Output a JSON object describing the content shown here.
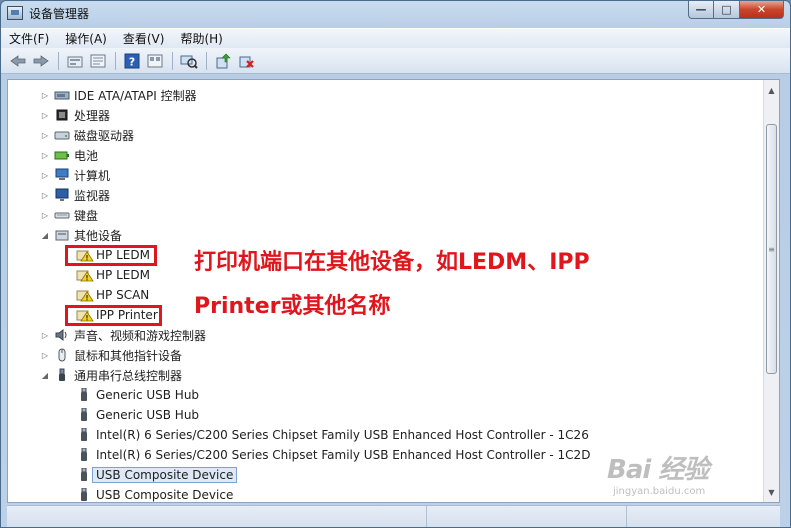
{
  "window": {
    "title": "设备管理器"
  },
  "caption": {
    "minimize": "—",
    "maximize": "□",
    "close": "✕"
  },
  "menu": [
    "文件(F)",
    "操作(A)",
    "查看(V)",
    "帮助(H)"
  ],
  "toolbar": [
    "back-arrow-icon",
    "forward-arrow-icon",
    "up-folder-icon",
    "properties-icon",
    "help-icon",
    "view-icon",
    "scan-hardware-icon",
    "update-driver-icon",
    "uninstall-icon"
  ],
  "tree": [
    {
      "label": "IDE ATA/ATAPI 控制器",
      "icon": "ide-controller-icon",
      "expander": "▷",
      "level": 0
    },
    {
      "label": "处理器",
      "icon": "processor-icon",
      "expander": "▷",
      "level": 0
    },
    {
      "label": "磁盘驱动器",
      "icon": "disk-drive-icon",
      "expander": "▷",
      "level": 0
    },
    {
      "label": "电池",
      "icon": "battery-icon",
      "expander": "▷",
      "level": 0
    },
    {
      "label": "计算机",
      "icon": "computer-icon",
      "expander": "▷",
      "level": 0
    },
    {
      "label": "监视器",
      "icon": "monitor-icon",
      "expander": "▷",
      "level": 0
    },
    {
      "label": "键盘",
      "icon": "keyboard-icon",
      "expander": "▷",
      "level": 0
    },
    {
      "label": "其他设备",
      "icon": "other-devices-icon",
      "expander": "◢",
      "level": 0
    },
    {
      "label": "HP LEDM",
      "icon": "unknown-device-warning-icon",
      "expander": "",
      "level": 1
    },
    {
      "label": "HP LEDM",
      "icon": "unknown-device-warning-icon",
      "expander": "",
      "level": 1
    },
    {
      "label": "HP SCAN",
      "icon": "unknown-device-warning-icon",
      "expander": "",
      "level": 1
    },
    {
      "label": "IPP Printer",
      "icon": "unknown-device-warning-icon",
      "expander": "",
      "level": 1
    },
    {
      "label": "声音、视频和游戏控制器",
      "icon": "sound-icon",
      "expander": "▷",
      "level": 0
    },
    {
      "label": "鼠标和其他指针设备",
      "icon": "mouse-icon",
      "expander": "▷",
      "level": 0
    },
    {
      "label": "通用串行总线控制器",
      "icon": "usb-controller-icon",
      "expander": "◢",
      "level": 0
    },
    {
      "label": "Generic USB Hub",
      "icon": "usb-plug-icon",
      "expander": "",
      "level": 1
    },
    {
      "label": "Generic USB Hub",
      "icon": "usb-plug-icon",
      "expander": "",
      "level": 1
    },
    {
      "label": "Intel(R) 6 Series/C200 Series Chipset Family USB Enhanced Host Controller - 1C26",
      "icon": "usb-plug-icon",
      "expander": "",
      "level": 1
    },
    {
      "label": "Intel(R) 6 Series/C200 Series Chipset Family USB Enhanced Host Controller - 1C2D",
      "icon": "usb-plug-icon",
      "expander": "",
      "level": 1
    },
    {
      "label": "USB Composite Device",
      "icon": "usb-plug-icon",
      "expander": "",
      "level": 1,
      "selected": true
    },
    {
      "label": "USB Composite Device",
      "icon": "usb-plug-icon",
      "expander": "",
      "level": 1
    }
  ],
  "scrollbar": {
    "up": "▲",
    "down": "▼",
    "grip": "≡"
  },
  "annotation": {
    "line1": "打印机端口在其他设备，如LEDM、IPP",
    "line2": "Printer或其他名称"
  },
  "watermark": {
    "logo": "Bai 经验",
    "url": "jingyan.baidu.com"
  },
  "colors": {
    "highlight": "#e0161c",
    "selection": "#dde9f6"
  }
}
